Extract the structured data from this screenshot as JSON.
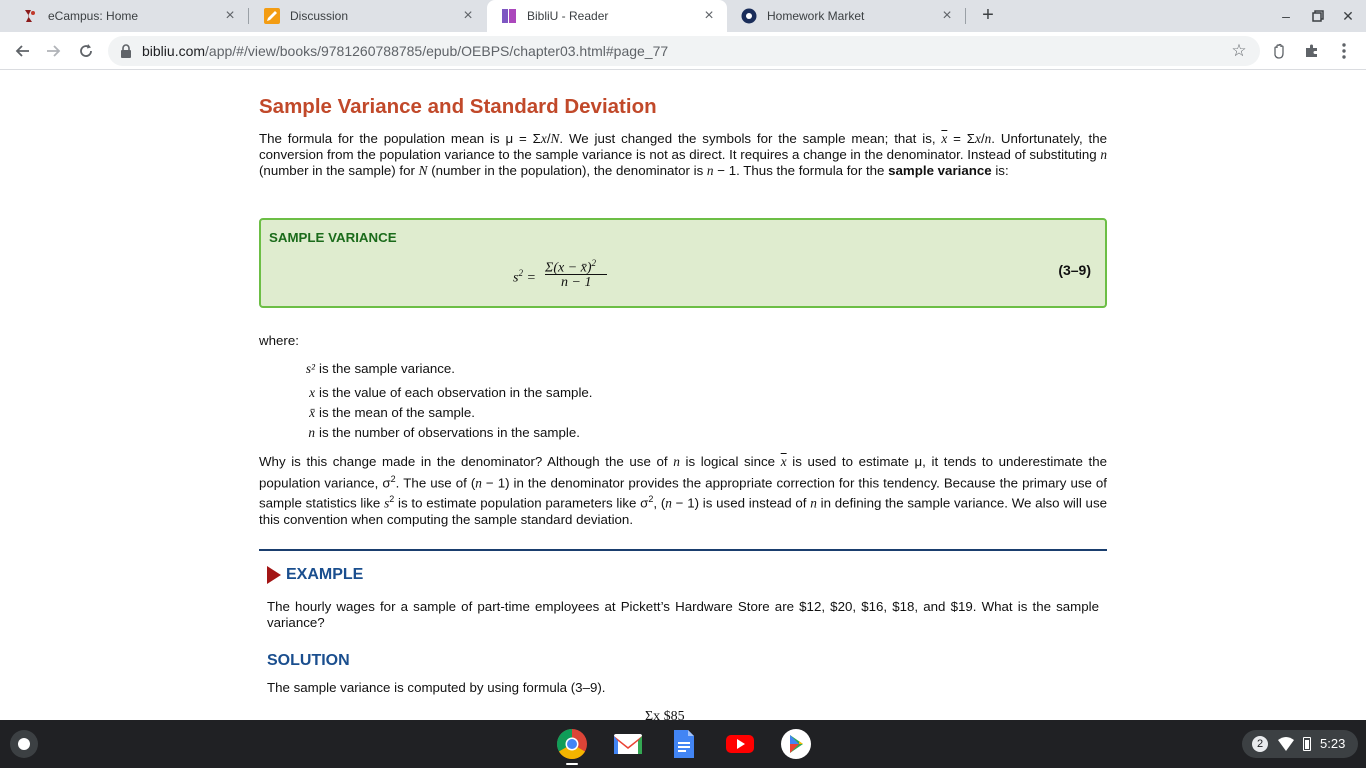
{
  "browser": {
    "tabs": [
      {
        "title": "eCampus: Home",
        "favicon": "ecampus-icon"
      },
      {
        "title": "Discussion",
        "favicon": "pencil-icon"
      },
      {
        "title": "BibliU - Reader",
        "favicon": "bibliu-icon",
        "active": true
      },
      {
        "title": "Homework Market",
        "favicon": "homework-market-icon"
      }
    ],
    "url_host": "bibliu.com",
    "url_path": "/app/#/view/books/9781260788785/epub/OEBPS/chapter03.html#page_77"
  },
  "article": {
    "title": "Sample Variance and Standard Deviation",
    "para1_html": "The formula for the population mean is μ = Σ<em>x</em>/<em>N</em>. We just changed the symbols for the sample mean; that is, <em style=\"text-decoration:overline\">x</em> = Σ<em>x</em>/<em>n</em>. Unfortunately, the conversion from the population variance to the sample variance is not as direct. It requires a change in the denominator. Instead of substituting <em>n</em> (number in the sample) for <em>N</em> (number in the population), the denominator is <em>n</em> − 1. Thus the formula for the <b>sample variance</b> is:",
    "box_title": "SAMPLE VARIANCE",
    "formula_lhs": "s",
    "formula_lhs_sup": "2",
    "formula_num": "Σ(x − x̄)",
    "formula_num_sup": "2",
    "formula_den": "n − 1",
    "formula_number": "(3–9)",
    "where_label": "where:",
    "definitions": [
      {
        "symbol": "s²",
        "text": "is the sample variance."
      },
      {
        "symbol": "x",
        "text": "is the value of each observation in the sample."
      },
      {
        "symbol": "x̄",
        "text": "is the mean of the sample."
      },
      {
        "symbol": "n",
        "text": "is the number of observations in the sample."
      }
    ],
    "para2_html": "Why is this change made in the denominator? Although the use of <em>n</em> is logical since <em style=\"text-decoration:overline\">x</em> is used to estimate μ, it tends to underestimate the population variance, σ<sup>2</sup>. The use of (<em>n</em> − 1) in the denominator provides the appropriate correction for this tendency. Because the primary use of sample statistics like <em>s</em><sup>2</sup> is to estimate population parameters like σ<sup>2</sup>, (<em>n</em> − 1) is used instead of <em>n</em> in defining the sample variance. We also will use this convention when computing the sample standard deviation.",
    "example_heading": "EXAMPLE",
    "example_text": "The hourly wages for a sample of part-time employees at Pickett’s Hardware Store are $12, $20, $16, $18, and $19. What is the sample variance?",
    "solution_heading": "SOLUTION",
    "solution_text": "The sample variance is computed by using formula (3–9).",
    "partial_line": "Σx     $85"
  },
  "shelf": {
    "apps": [
      "chrome-icon",
      "gmail-icon",
      "docs-icon",
      "youtube-icon",
      "play-store-icon"
    ],
    "notification_count": "2",
    "time": "5:23"
  },
  "colors": {
    "title": "#c1492a",
    "box_bg": "#dfeccf",
    "box_border": "#6cbe45",
    "heading_blue": "#1a4e8e"
  }
}
